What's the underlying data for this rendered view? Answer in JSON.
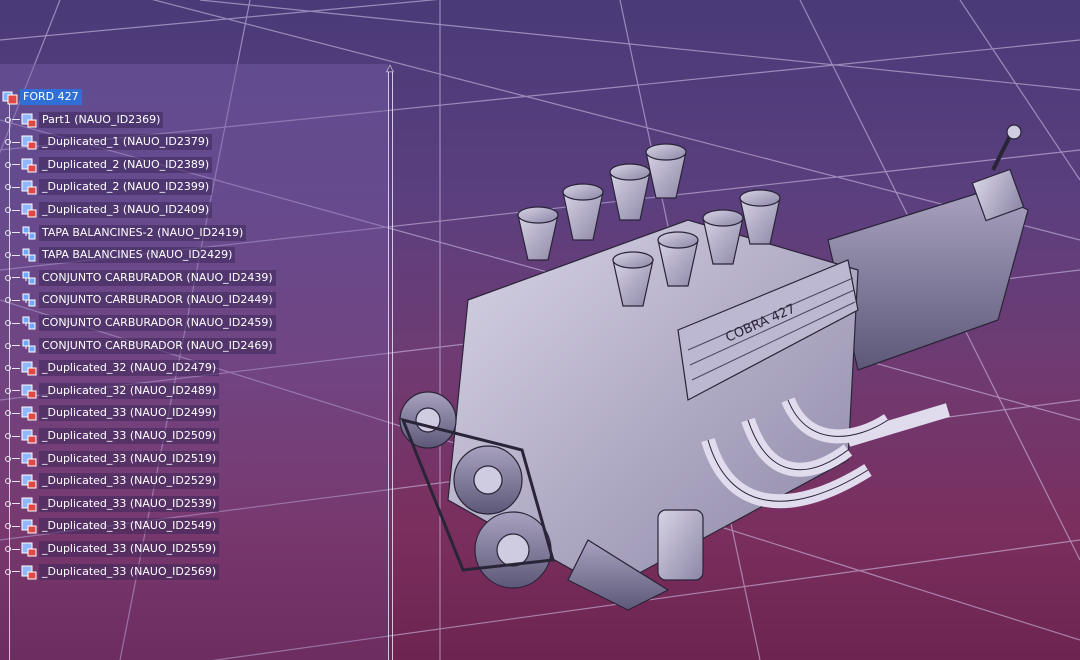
{
  "window": {
    "background_top": "#4a3a78",
    "background_bottom": "#6d2450",
    "grid_color": "#d9c9f0"
  },
  "tree": {
    "selected_color": "#2f6fd6",
    "items": [
      {
        "label": "FORD 427",
        "icon": "product-icon",
        "root": true
      },
      {
        "label": "Part1 (NAUO_ID2369)",
        "icon": "part-icon"
      },
      {
        "label": "_Duplicated_1 (NAUO_ID2379)",
        "icon": "part-icon"
      },
      {
        "label": "_Duplicated_2 (NAUO_ID2389)",
        "icon": "part-icon"
      },
      {
        "label": "_Duplicated_2 (NAUO_ID2399)",
        "icon": "part-icon"
      },
      {
        "label": "_Duplicated_3 (NAUO_ID2409)",
        "icon": "part-icon"
      },
      {
        "label": "TAPA BALANCINES-2 (NAUO_ID2419)",
        "icon": "assembly-icon"
      },
      {
        "label": "TAPA BALANCINES (NAUO_ID2429)",
        "icon": "assembly-icon"
      },
      {
        "label": "CONJUNTO CARBURADOR (NAUO_ID2439)",
        "icon": "assembly-icon"
      },
      {
        "label": "CONJUNTO CARBURADOR (NAUO_ID2449)",
        "icon": "assembly-icon"
      },
      {
        "label": "CONJUNTO CARBURADOR (NAUO_ID2459)",
        "icon": "assembly-icon"
      },
      {
        "label": "CONJUNTO CARBURADOR (NAUO_ID2469)",
        "icon": "assembly-icon"
      },
      {
        "label": "_Duplicated_32 (NAUO_ID2479)",
        "icon": "part-icon"
      },
      {
        "label": "_Duplicated_32 (NAUO_ID2489)",
        "icon": "part-icon"
      },
      {
        "label": "_Duplicated_33 (NAUO_ID2499)",
        "icon": "part-icon"
      },
      {
        "label": "_Duplicated_33 (NAUO_ID2509)",
        "icon": "part-icon"
      },
      {
        "label": "_Duplicated_33 (NAUO_ID2519)",
        "icon": "part-icon"
      },
      {
        "label": "_Duplicated_33 (NAUO_ID2529)",
        "icon": "part-icon"
      },
      {
        "label": "_Duplicated_33 (NAUO_ID2539)",
        "icon": "part-icon"
      },
      {
        "label": "_Duplicated_33 (NAUO_ID2549)",
        "icon": "part-icon"
      },
      {
        "label": "_Duplicated_33 (NAUO_ID2559)",
        "icon": "part-icon"
      },
      {
        "label": "_Duplicated_33 (NAUO_ID2569)",
        "icon": "part-icon"
      }
    ]
  },
  "model": {
    "name_plate": "COBRA 427"
  }
}
